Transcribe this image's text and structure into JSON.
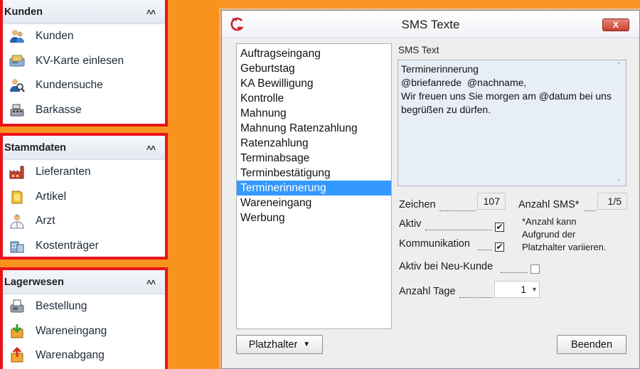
{
  "nav": {
    "groups": [
      {
        "title": "Kunden",
        "items": [
          "Kunden",
          "KV-Karte einlesen",
          "Kundensuche",
          "Barkasse"
        ]
      },
      {
        "title": "Stammdaten",
        "items": [
          "Lieferanten",
          "Artikel",
          "Arzt",
          "Kostenträger"
        ]
      },
      {
        "title": "Lagerwesen",
        "items": [
          "Bestellung",
          "Wareneingang",
          "Warenabgang"
        ]
      }
    ],
    "collapse_glyph": "˄˄"
  },
  "dialog": {
    "title": "SMS Texte",
    "close_label": "X",
    "templates": [
      "Auftragseingang",
      "Geburtstag",
      "KA Bewilligung",
      "Kontrolle",
      "Mahnung",
      "Mahnung Ratenzahlung",
      "Ratenzahlung",
      "Terminabsage",
      "Terminbestätigung",
      "Terminerinnerung",
      "Wareneingang",
      "Werbung"
    ],
    "selected_template": "Terminerinnerung",
    "sms_text_label": "SMS Text",
    "sms_text": "Terminerinnerung\n@briefanrede  @nachname,\nWir freuen uns Sie morgen am @datum bei uns begrüßen zu dürfen.",
    "zeichen_label": "Zeichen",
    "zeichen_value": "107",
    "anzahl_sms_label": "Anzahl SMS*",
    "anzahl_sms_value": "1/5",
    "note_lines": [
      "*Anzahl kann",
      "Aufgrund der",
      "Platzhalter variieren."
    ],
    "aktiv_label": "Aktiv",
    "aktiv_checked": true,
    "kommunikation_label": "Kommunikation",
    "kommunikation_checked": true,
    "aktiv_neu_label": "Aktiv bei Neu-Kunde",
    "aktiv_neu_checked": false,
    "anzahl_tage_label": "Anzahl Tage",
    "anzahl_tage_value": "1",
    "platzhalter_label": "Platzhalter",
    "beenden_label": "Beenden"
  },
  "colors": {
    "background": "#f7931e",
    "nav_border": "#e8141c",
    "selection": "#3399ff",
    "sms_box": "#e8eef7"
  }
}
